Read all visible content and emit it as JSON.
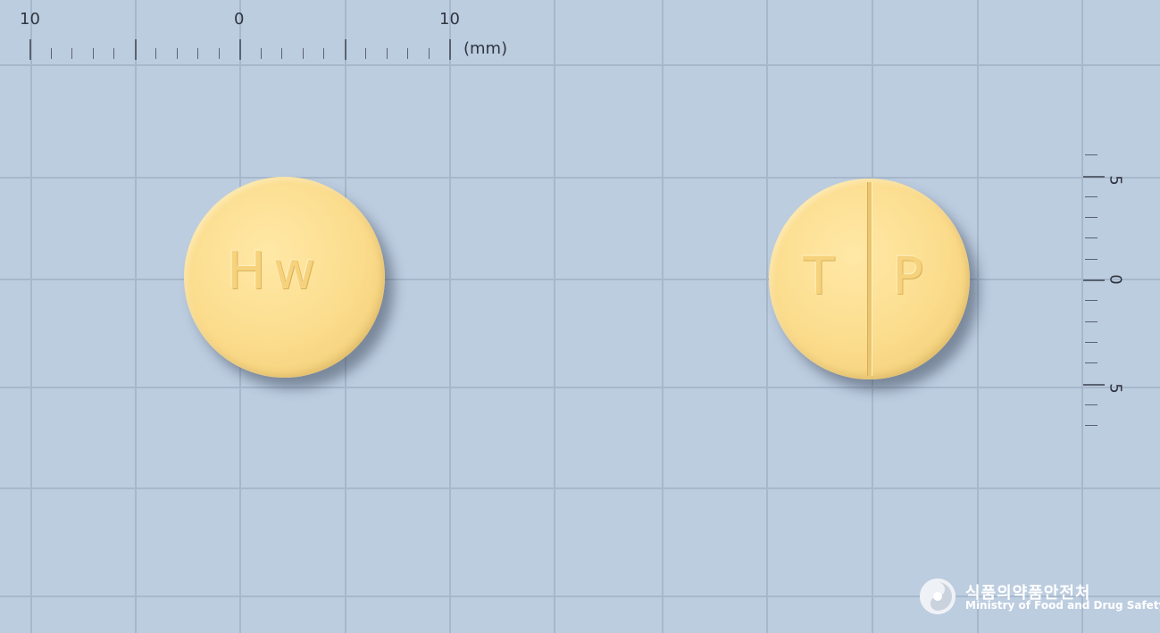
{
  "ruler_top": {
    "labels": [
      "10",
      "0",
      "10"
    ],
    "unit": "(mm)"
  },
  "ruler_right": {
    "labels": [
      "5",
      "0",
      "5"
    ]
  },
  "tablet_front": {
    "imprint": "Hw",
    "color": "#fbdc8c"
  },
  "tablet_back": {
    "imprint_left": "T",
    "imprint_right": "P",
    "score_line": true,
    "color": "#fbdc8c"
  },
  "logo": {
    "korean": "식품의약품안전처",
    "english": "Ministry of Food and Drug Safety",
    "icon": "mfds-taegeuk-icon"
  },
  "colors": {
    "background": "#bdcde0",
    "grid": "#a7b8cc"
  }
}
